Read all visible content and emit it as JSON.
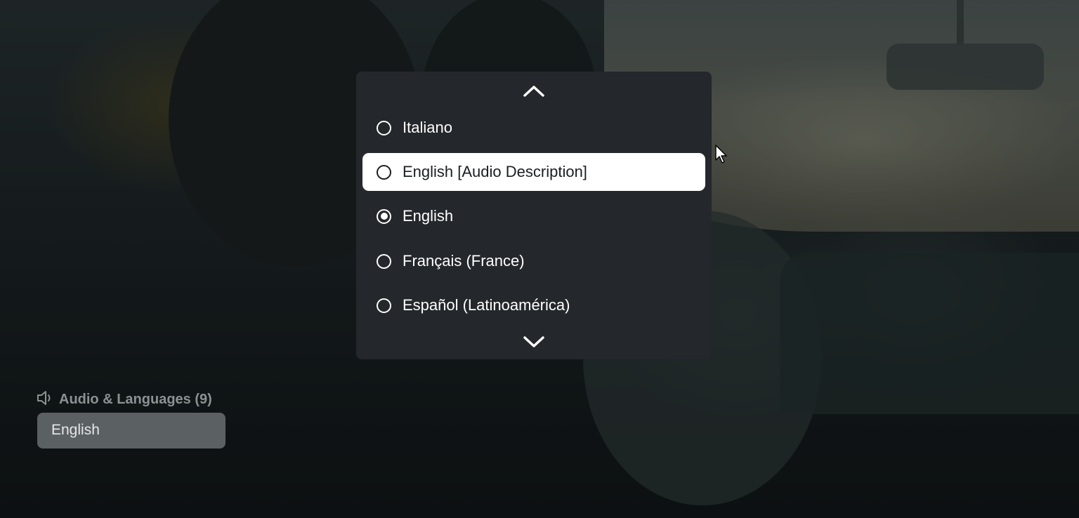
{
  "player": {
    "language_menu": {
      "scroll_up_icon": "chevron-up-icon",
      "scroll_down_icon": "chevron-down-icon",
      "options": [
        {
          "label": "Italiano",
          "selected": false,
          "focused": false
        },
        {
          "label": "English [Audio Description]",
          "selected": false,
          "focused": true
        },
        {
          "label": "English",
          "selected": true,
          "focused": false
        },
        {
          "label": "Français (France)",
          "selected": false,
          "focused": false
        },
        {
          "label": "Español (Latinoamérica)",
          "selected": false,
          "focused": false
        }
      ]
    },
    "audio_section": {
      "icon": "speaker-icon",
      "heading": "Audio & Languages (9)",
      "current_value": "English"
    },
    "colors": {
      "panel_bg": "#24272b",
      "focus_bg": "#ffffff",
      "text_primary": "#ffffff",
      "section_heading": "#8c9194",
      "value_box": "#5b6063"
    }
  }
}
